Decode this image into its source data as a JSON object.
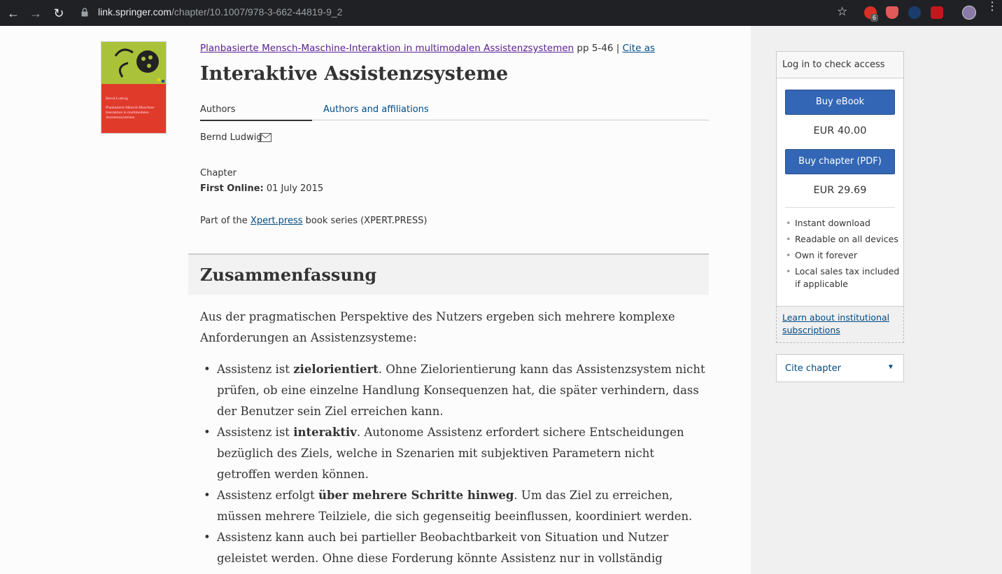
{
  "browser": {
    "url_host": "link.springer.com",
    "url_path": "/chapter/10.1007/978-3-662-44819-9_2",
    "extension_badge": "6"
  },
  "book_cover": {
    "author": "Bernd Ludwig",
    "title_line": "Planbasierte Mensch-Maschine-Interaktion in multimodalen Assistenzsystemen"
  },
  "breadcrumb": {
    "book_title": "Planbasierte Mensch-Maschine-Interaktion in multimodalen Assistenzsystemen",
    "pages": "pp 5-46",
    "separator": "|",
    "cite_as": "Cite as"
  },
  "page_title": "Interaktive Assistenzsysteme",
  "tabs": [
    {
      "label": "Authors"
    },
    {
      "label": "Authors and affiliations"
    }
  ],
  "author_name": "Bernd Ludwig",
  "meta": {
    "type": "Chapter",
    "first_online_label": "First Online:",
    "first_online_value": " 01 July 2015",
    "series_prefix": "Part of the ",
    "series_link": "Xpert.press",
    "series_suffix": " book series (XPERT.PRESS)"
  },
  "section_title": "Zusammenfassung",
  "abstract_intro": "Aus der pragmatischen Perspektive des Nutzers ergeben sich mehrere komplexe Anforderungen an Assistenzsysteme:",
  "abstract_items": [
    {
      "pre": "Assistenz ist ",
      "bold": "zielorientiert",
      "post": ". Ohne Zielorientierung kann das Assistenzsystem nicht prüfen, ob eine einzelne Handlung Konsequenzen hat, die später verhindern, dass der Benutzer sein Ziel erreichen kann."
    },
    {
      "pre": "Assistenz ist ",
      "bold": "interaktiv",
      "post": ". Autonome Assistenz erfordert sichere Entscheidungen bezüglich des Ziels, welche in Szenarien mit subjektiven Parametern nicht getroffen werden können."
    },
    {
      "pre": "Assistenz erfolgt ",
      "bold": "über mehrere Schritte hinweg",
      "post": ". Um das Ziel zu erreichen, müssen mehrere Teilziele, die sich gegenseitig beeinflussen, koordiniert werden."
    },
    {
      "pre": "Assistenz kann auch bei partieller Beobachtbarkeit von Situation und Nutzer geleistet werden. Ohne diese Forderung könnte Assistenz nur in vollständig kontrollierten Umgebungen geleistet werden.",
      "bold": "",
      "post": ""
    }
  ],
  "buybox": {
    "header": "Log in to check access",
    "ebook_button": "Buy eBook",
    "ebook_price": "EUR 40.00",
    "chapter_button": "Buy chapter (PDF)",
    "chapter_price": "EUR 29.69",
    "features": [
      "Instant download",
      "Readable on all devices",
      "Own it forever",
      "Local sales tax included if applicable"
    ],
    "institutional_link": "Learn about institutional subscriptions"
  },
  "cite_chapter": "Cite chapter",
  "colors": {
    "link": "#004b83",
    "visited_link": "#5a1e91",
    "button": "#3367b5"
  }
}
